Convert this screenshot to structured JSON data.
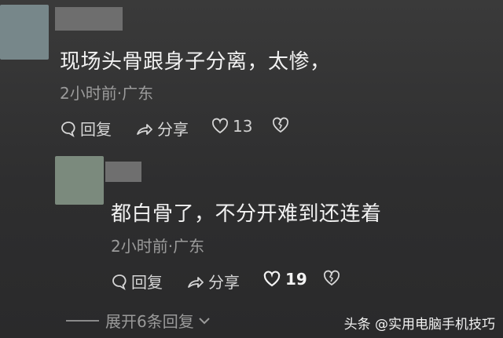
{
  "comments": [
    {
      "text": "现场头骨跟身子分离，太惨，",
      "meta": "2小时前·广东",
      "reply_label": "回复",
      "share_label": "分享",
      "likes": "13"
    },
    {
      "text": "都白骨了，不分开难到还连着",
      "meta": "2小时前·广东",
      "reply_label": "回复",
      "share_label": "分享",
      "likes": "19"
    }
  ],
  "expand_replies": "展开6条回复",
  "watermark": "头条 @实用电脑手机技巧",
  "colors": {
    "background": "#2e2e2f",
    "text": "#f1f1f1",
    "meta": "#9b9b9b"
  }
}
